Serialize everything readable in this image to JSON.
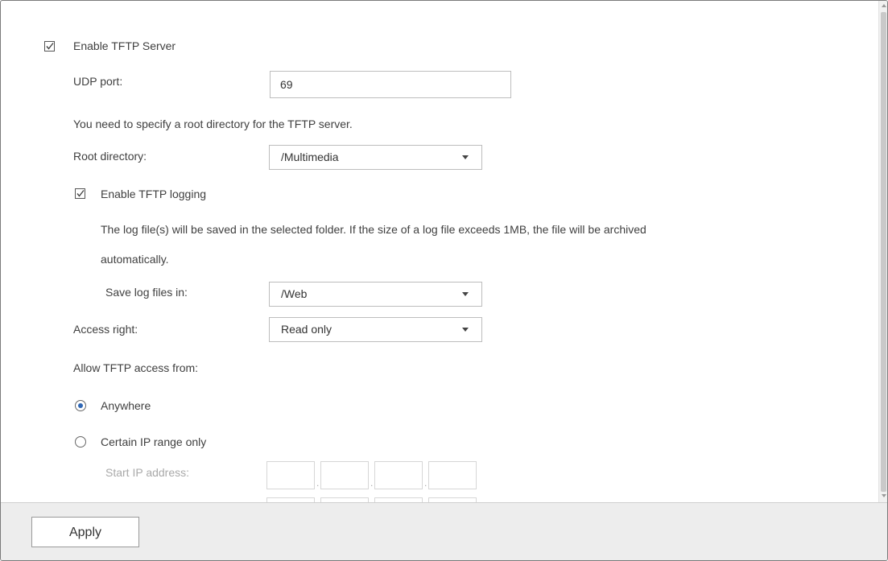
{
  "tftp": {
    "enable_server_label": "Enable TFTP Server",
    "enable_server_checked": true,
    "udp_port_label": "UDP port:",
    "udp_port_value": "69",
    "root_dir_note": "You need to specify a root directory for the TFTP server.",
    "root_dir_label": "Root directory:",
    "root_dir_value": "/Multimedia",
    "enable_logging_label": "Enable TFTP logging",
    "enable_logging_checked": true,
    "log_note_line1": "The log file(s) will be saved in the selected folder. If the size of a log file exceeds 1MB, the file will be archived",
    "log_note_line2": "automatically.",
    "save_log_label": "Save log files in:",
    "save_log_value": "/Web",
    "access_right_label": "Access right:",
    "access_right_value": "Read only",
    "allow_access_label": "Allow TFTP access from:",
    "anywhere_label": "Anywhere",
    "anywhere_selected": true,
    "ip_range_label": "Certain IP range only",
    "ip_range_selected": false,
    "start_ip_label": "Start IP address:"
  },
  "footer": {
    "apply_label": "Apply"
  },
  "colors": {
    "radio_selected": "#2f67b5",
    "footer_bg": "#ededed"
  }
}
